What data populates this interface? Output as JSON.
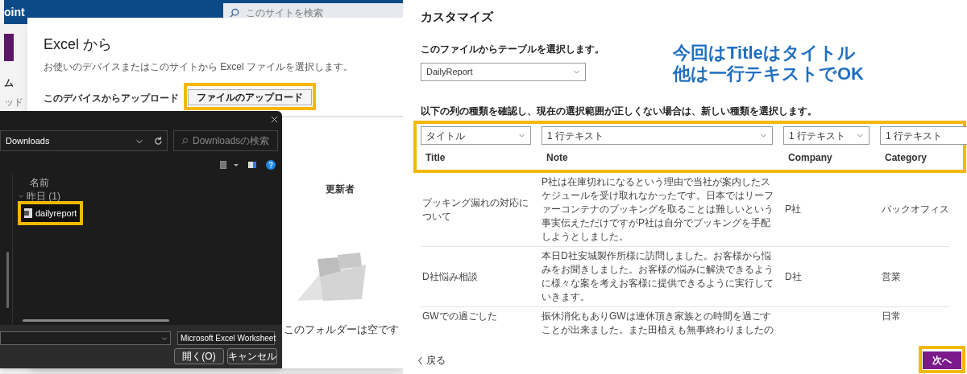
{
  "sharepoint": {
    "brand": "oint",
    "search_placeholder": "このサイトを検索",
    "nav_items": [
      "ム",
      "ッド"
    ]
  },
  "excel_dialog": {
    "title": "Excel から",
    "description": "お使いのデバイスまたはこのサイトから Excel ファイルを選択します。",
    "upload_label": "このデバイスからアップロード",
    "upload_button": "ファイルのアップロード",
    "column_header": "更新者",
    "empty_message": "このフォルダーは空です"
  },
  "file_picker": {
    "folder": "Downloads",
    "search_placeholder": "Downloadsの検索",
    "column": "名前",
    "groups": [
      {
        "label": "昨日 (1)",
        "expanded": true,
        "files": [
          "dailyreport"
        ]
      }
    ],
    "file_type": "Microsoft Excel Worksheet",
    "buttons": [
      "開く(O)",
      "キャンセル"
    ]
  },
  "customize": {
    "title": "カスタマイズ",
    "table_prompt": "このファイルからテーブルを選択します。",
    "table_select": "DailyReport",
    "columns_prompt": "以下の列の種類を確認し、現在の選択範囲が正しくない場合は、新しい種類を選択します。",
    "columns": [
      {
        "type": "タイトル",
        "name": "Title"
      },
      {
        "type": "1 行テキスト",
        "name": "Note"
      },
      {
        "type": "1 行テキスト",
        "name": "Company"
      },
      {
        "type": "1 行テキスト",
        "name": "Category"
      }
    ],
    "rows": [
      [
        "ブッキング漏れの対応について",
        "P社は在庫切れになるという理由で当社が案内したスケジュールを受け取れなかったです。日本ではリーファーコンテナのブッキングを取ることは難しいという事実伝えただけですがP社は自分でブッキングを手配しようとしました。",
        "P社",
        "バックオフィス"
      ],
      [
        "D社悩み相談",
        "本日D社安城製作所様に訪問しました。お客様から悩みをお聞きしました。お客様の悩みに解決できるように様々な案を考えお客様に提供できるように実行していきます。",
        "D社",
        "営業"
      ],
      [
        "GWでの過ごした",
        "振休消化もありGWは連休頂き家族との時間を過ごすことが出来ました。また田植えも無事終わりましたの",
        "",
        "日常"
      ]
    ],
    "back": "戻る",
    "next": "次へ"
  },
  "annotation": {
    "lines": [
      "今回はTitleはタイトル",
      "他は一行テキストでOK"
    ]
  }
}
